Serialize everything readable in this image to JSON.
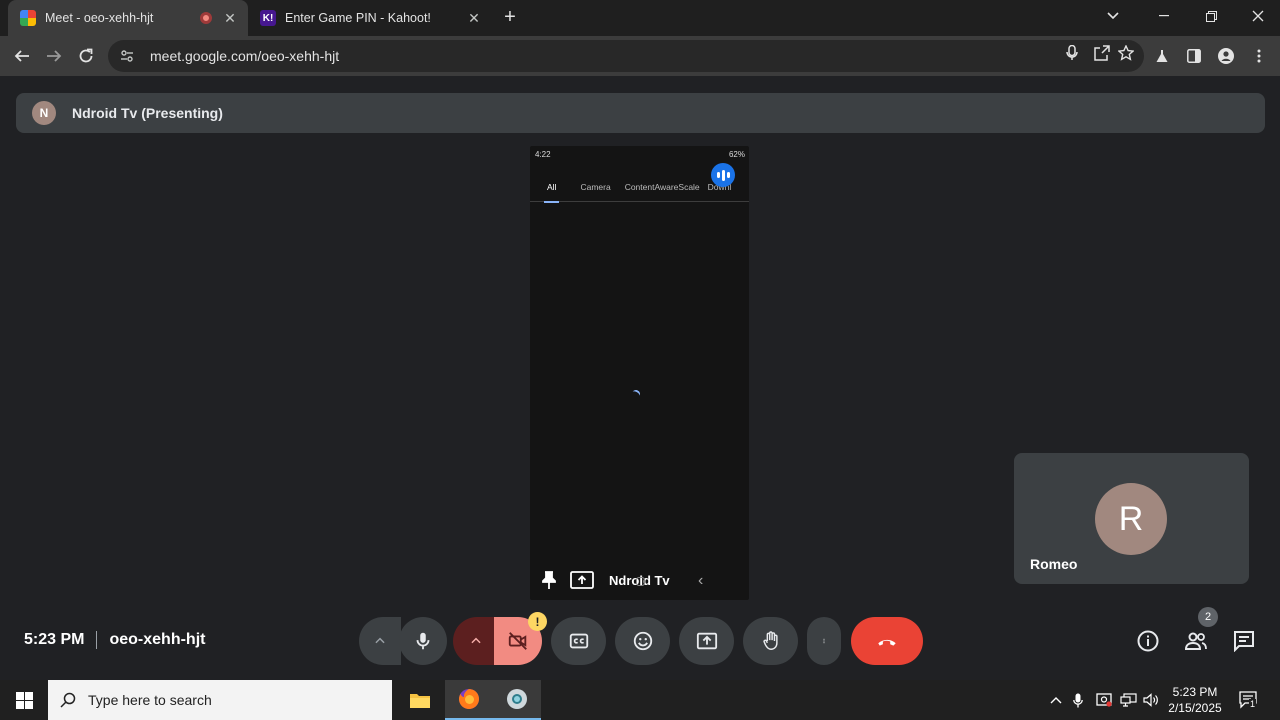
{
  "browser": {
    "tabs": [
      {
        "title": "Meet - oeo-xehh-hjt",
        "active": true
      },
      {
        "title": "Enter Game PIN - Kahoot!",
        "active": false,
        "favicon_text": "K!"
      }
    ],
    "url": "meet.google.com/oeo-xehh-hjt"
  },
  "meet": {
    "presenter_avatar_letter": "N",
    "presenting_label": "Ndroid Tv (Presenting)",
    "shared_screen": {
      "status_time": "4:22",
      "status_battery": "62%",
      "tabs": [
        "All",
        "Camera",
        "ContentAwareScale",
        "Downl"
      ],
      "presenter_name": "Ndroid Tv"
    },
    "self_tile": {
      "avatar_letter": "R",
      "name": "Romeo"
    },
    "time": "5:23 PM",
    "meeting_code": "oeo-xehh-hjt",
    "camera_warning": "!",
    "participant_count": "2",
    "colors": {
      "end_call": "#ea4335",
      "camera_off_bg": "#f28b82",
      "avatar": "#a1887f"
    }
  },
  "taskbar": {
    "search_placeholder": "Type here to search",
    "clock_time": "5:23 PM",
    "clock_date": "2/15/2025",
    "notification_count": "1"
  }
}
